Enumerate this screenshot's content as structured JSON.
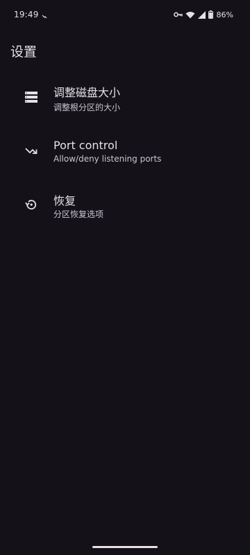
{
  "status_bar": {
    "time": "19:49",
    "battery": "86%",
    "icons": [
      "notification-icon",
      "vpn-key-icon",
      "wifi-icon",
      "signal-icon",
      "battery-icon"
    ]
  },
  "page": {
    "title": "设置"
  },
  "settings": [
    {
      "icon": "storage-icon",
      "title": "调整磁盘大小",
      "subtitle": "调整根分区的大小"
    },
    {
      "icon": "port-forward-icon",
      "title": "Port control",
      "subtitle": "Allow/deny listening ports"
    },
    {
      "icon": "restore-icon",
      "title": "恢复",
      "subtitle": "分区恢复选项"
    }
  ],
  "colors": {
    "background": "#141218",
    "text_primary": "#e6e1e5",
    "text_secondary": "#cac4d0"
  }
}
